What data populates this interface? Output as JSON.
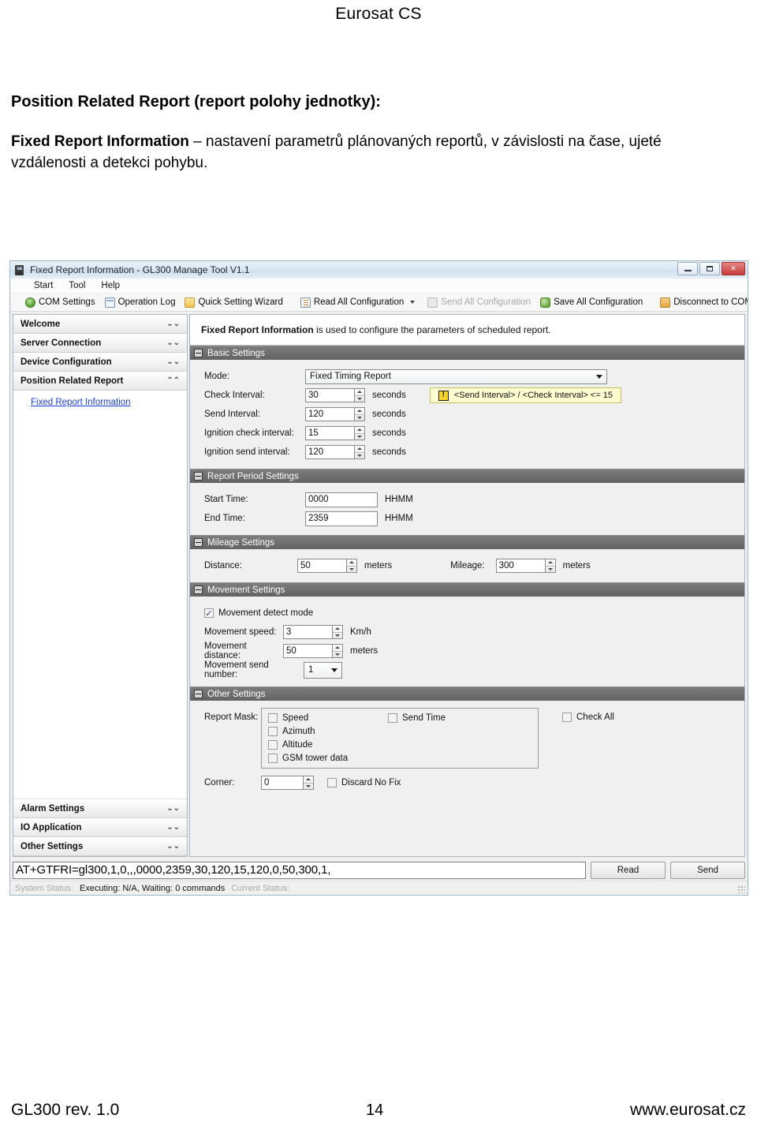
{
  "document": {
    "header": "Eurosat CS",
    "heading": "Position Related Report (report polohy jednotky):",
    "paragraph_bold": "Fixed Report Information",
    "paragraph_rest": " – nastavení parametrů plánovaných reportů, v závislosti na čase, ujeté vzdálenosti a detekci pohybu.",
    "footer_left": "GL300 rev. 1.0",
    "footer_page": "14",
    "footer_right": "www.eurosat.cz"
  },
  "app": {
    "title": "Fixed Report Information - GL300 Manage Tool V1.1",
    "window_buttons": {
      "minimize": "minimize-button",
      "maximize": "maximize-button",
      "close": "✕"
    },
    "menu": [
      "Start",
      "Tool",
      "Help"
    ],
    "toolbar": [
      {
        "label": "COM Settings",
        "icon": "com-settings-icon",
        "disabled": false
      },
      {
        "label": "Operation Log",
        "icon": "operation-log-icon",
        "disabled": false
      },
      {
        "label": "Quick Setting Wizard",
        "icon": "quick-setting-wizard-icon",
        "disabled": false
      },
      {
        "label": "Read All Configuration",
        "icon": "read-all-configuration-icon",
        "disabled": false
      },
      {
        "label": "Send All Configuration",
        "icon": "send-all-configuration-icon",
        "disabled": true
      },
      {
        "label": "Save All Configuration",
        "icon": "save-all-configuration-icon",
        "disabled": false
      },
      {
        "label": "Disconnect to COM",
        "icon": "disconnect-to-com-icon",
        "disabled": false
      }
    ]
  },
  "sidebar": {
    "sections": [
      {
        "label": "Welcome",
        "expanded": false,
        "chevron": "⌄⌄"
      },
      {
        "label": "Server Connection",
        "expanded": false,
        "chevron": "⌄⌄"
      },
      {
        "label": "Device Configuration",
        "expanded": false,
        "chevron": "⌄⌄"
      },
      {
        "label": "Position Related Report",
        "expanded": true,
        "chevron": "⌃⌃"
      }
    ],
    "active_link": "Fixed Report Information",
    "bottom_sections": [
      {
        "label": "Alarm Settings",
        "chevron": "⌄⌄"
      },
      {
        "label": "IO Application",
        "chevron": "⌄⌄"
      },
      {
        "label": "Other Settings",
        "chevron": "⌄⌄"
      }
    ]
  },
  "content": {
    "intro_bold": "Fixed Report Information",
    "intro_rest": " is used to configure the parameters of scheduled report.",
    "basic_settings": {
      "title": "Basic Settings",
      "mode_label": "Mode:",
      "mode_value": "Fixed Timing Report",
      "rows": [
        {
          "label": "Check Interval:",
          "value": "30",
          "unit": "seconds"
        },
        {
          "label": "Send Interval:",
          "value": "120",
          "unit": "seconds"
        },
        {
          "label": "Ignition check interval:",
          "value": "15",
          "unit": "seconds"
        },
        {
          "label": "Ignition send interval:",
          "value": "120",
          "unit": "seconds"
        }
      ],
      "warning": "<Send Interval> / <Check Interval> <= 15",
      "warning_icon": "!"
    },
    "report_period_settings": {
      "title": "Report Period Settings",
      "rows": [
        {
          "label": "Start Time:",
          "value": "0000",
          "unit": "HHMM"
        },
        {
          "label": "End Time:",
          "value": "2359",
          "unit": "HHMM"
        }
      ]
    },
    "mileage_settings": {
      "title": "Mileage Settings",
      "distance_label": "Distance:",
      "distance_value": "50",
      "distance_unit": "meters",
      "mileage_label": "Mileage:",
      "mileage_value": "300",
      "mileage_unit": "meters"
    },
    "movement_settings": {
      "title": "Movement Settings",
      "detect_mode_label": "Movement detect mode",
      "detect_mode_checked": true,
      "speed_label": "Movement speed:",
      "speed_value": "3",
      "speed_unit": "Km/h",
      "distance_label": "Movement distance:",
      "distance_value": "50",
      "distance_unit": "meters",
      "send_number_label": "Movement send number:",
      "send_number_value": "1"
    },
    "other_settings": {
      "title": "Other Settings",
      "report_mask_label": "Report Mask:",
      "mask_col1": [
        "Speed",
        "Azimuth",
        "Altitude",
        "GSM tower data"
      ],
      "mask_col2": [
        "Send Time"
      ],
      "check_all_label": "Check All",
      "corner_label": "Corner:",
      "corner_value": "0",
      "discard_no_fix_label": "Discard No Fix"
    },
    "command_bar": {
      "command": "AT+GTFRI=gl300,1,0,,,0000,2359,30,120,15,120,0,50,300,1,",
      "read_button": "Read",
      "send_button": "Send"
    },
    "statusbar": {
      "system_status_label": "System Status:",
      "system_status_value": "Executing: N/A, Waiting: 0 commands",
      "current_status_label": "Current Status:"
    }
  },
  "colors": {
    "panel_header": "#6c6c6c",
    "link": "#1a3fd4",
    "warning_bg": "#fdfbd0",
    "close_button": "#c43b3b"
  }
}
